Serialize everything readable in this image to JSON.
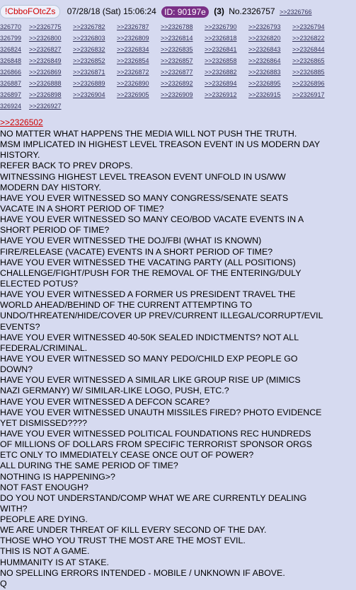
{
  "header": {
    "tripcode": "!CbboFOtcZs",
    "datetime": "07/28/18 (Sat) 15:06:24",
    "id_label": "ID: 90197e",
    "reply_count": "(3)",
    "post_number": "No.2326757",
    "first_backlink": ">>2326766"
  },
  "backlinks": [
    [
      "326770",
      ">>2326775",
      ">>2326782",
      ">>2326787",
      ">>2326788",
      ">>2326790",
      ">>2326793",
      ">>2326794"
    ],
    [
      "326799",
      ">>2326800",
      ">>2326803",
      ">>2326809",
      ">>2326814",
      ">>2326818",
      ">>2326820",
      ">>2326822"
    ],
    [
      "326824",
      ">>2326827",
      ">>2326832",
      ">>2326834",
      ">>2326835",
      ">>2326841",
      ">>2326843",
      ">>2326844"
    ],
    [
      "326848",
      ">>2326849",
      ">>2326852",
      ">>2326854",
      ">>2326857",
      ">>2326858",
      ">>2326864",
      ">>2326865"
    ],
    [
      "326866",
      ">>2326869",
      ">>2326871",
      ">>2326872",
      ">>2326877",
      ">>2326882",
      ">>2326883",
      ">>2326885"
    ],
    [
      "326887",
      ">>2326888",
      ">>2326889",
      ">>2326890",
      ">>2326892",
      ">>2326894",
      ">>2326895",
      ">>2326896"
    ],
    [
      "326897",
      ">>2326898",
      ">>2326904",
      ">>2326905",
      ">>2326909",
      ">>2326912",
      ">>2326915",
      ">>2326917"
    ],
    [
      "326924",
      ">>2326927"
    ]
  ],
  "quote_link": ">>2326502",
  "body_lines": [
    "NO MATTER WHAT HAPPENS THE MEDIA WILL NOT PUSH THE TRUTH.",
    "MSM IMPLICATED IN HIGHEST LEVEL TREASON EVENT IN US MODERN DAY",
    "HISTORY.",
    "REFER BACK TO PREV DROPS.",
    "WITNESSING HIGHEST LEVEL TREASON EVENT UNFOLD IN US/WW",
    "MODERN DAY HISTORY.",
    "HAVE YOU EVER WITNESSED SO MANY CONGRESS/SENATE SEATS",
    "VACATE IN A SHORT PERIOD OF TIME?",
    "HAVE YOU EVER WITNESSED SO MANY CEO/BOD VACATE EVENTS IN A",
    "SHORT PERIOD OF TIME?",
    "HAVE YOU EVER WITNESSED THE DOJ/FBI (WHAT IS KNOWN)",
    "FIRE/RELEASE (VACATE) EVENTS IN A SHORT PERIOD OF TIME?",
    "HAVE YOU EVER WITNESSED THE VACATING PARTY (ALL POSITIONS)",
    "CHALLENGE/FIGHT/PUSH FOR THE REMOVAL OF THE ENTERING/DULY",
    "ELECTED POTUS?",
    "HAVE YOU EVER WITNESSED A FORMER US PRESIDENT TRAVEL THE",
    "WORLD AHEAD/BEHIND OF THE CURRENT ATTEMPTING TO",
    "UNDO/THREATEN/HIDE/COVER UP PREV/CURRENT ILLEGAL/CORRUPT/EVIL",
    "EVENTS?",
    "HAVE YOU EVER WITNESSED 40-50K SEALED INDICTMENTS? NOT ALL",
    "FEDERAL/CRIMINAL.",
    "HAVE YOU EVER WITNESSED SO MANY PEDO/CHILD EXP PEOPLE GO",
    "DOWN?",
    "HAVE YOU EVER WITNESSED A SIMILAR LIKE GROUP RISE UP (MIMICS",
    "NAZI GERMANY) W/ SIMILAR-LIKE LOGO, PUSH, ETC.?",
    "HAVE YOU EVER WITNESSED A DEFCON SCARE?",
    "HAVE YOU EVER WITNESSED UNAUTH MISSILES FIRED? PHOTO EVIDENCE",
    "YET DISMISSED????",
    "HAVE YOU EVER WITNESSED POLITICAL FOUNDATIONS REC HUNDREDS",
    "OF MILLIONS OF DOLLARS FROM SPECIFIC TERRORIST SPONSOR ORGS",
    "ETC ONLY TO IMMEDIATELY CEASE ONCE OUT OF POWER?",
    "ALL DURING THE SAME PERIOD OF TIME?",
    "NOTHING IS HAPPENING>?",
    "NOT FAST ENOUGH?",
    "DO YOU NOT UNDERSTAND/COMP WHAT WE ARE CURRENTLY DEALING",
    "WITH?",
    "PEOPLE ARE DYING.",
    "WE ARE UNDER THREAT OF KILL EVERY SECOND OF THE DAY.",
    "THOSE WHO YOU TRUST THE MOST ARE THE MOST EVIL.",
    "THIS IS NOT A GAME.",
    "HUMMANITY IS AT STAKE.",
    "NO SPELLING ERRORS INTENDED - MOBILE / UNKNOWN IF ABOVE.",
    "Q"
  ],
  "colors": {
    "background": "#d6daf0",
    "link": "#34345c",
    "quote_link": "#d00000",
    "id_badge": "#7a2f86"
  }
}
